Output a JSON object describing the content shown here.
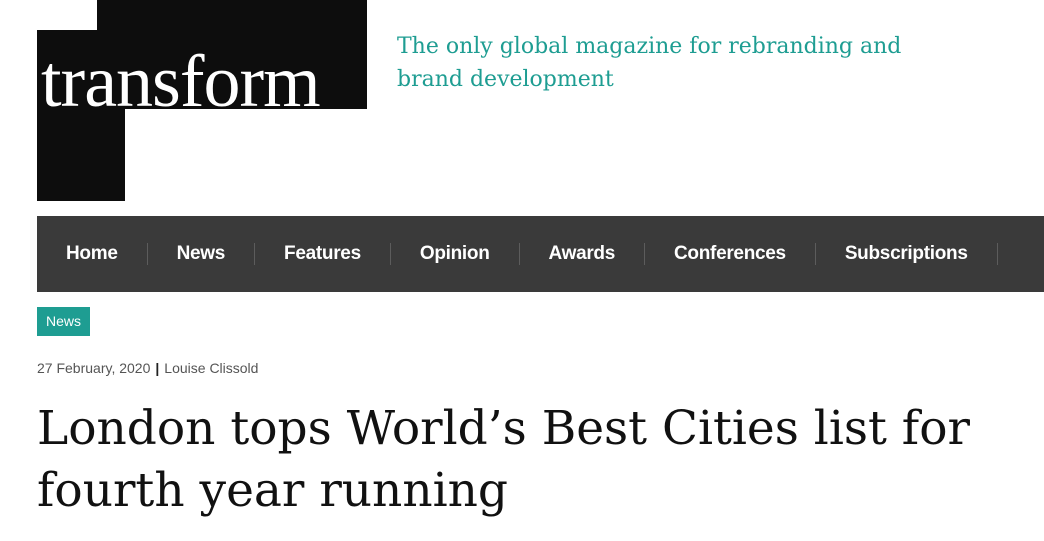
{
  "logo": {
    "text": "transform"
  },
  "tagline": "The only global magazine for rebranding and brand development",
  "nav": {
    "items": [
      {
        "label": "Home"
      },
      {
        "label": "News"
      },
      {
        "label": "Features"
      },
      {
        "label": "Opinion"
      },
      {
        "label": "Awards"
      },
      {
        "label": "Conferences"
      },
      {
        "label": "Subscriptions"
      }
    ]
  },
  "article": {
    "category": "News",
    "date": "27 February, 2020",
    "separator": "|",
    "author": "Louise Clissold",
    "title": "London tops World’s Best Cities list for fourth year running"
  },
  "colors": {
    "accent": "#1e9d92",
    "nav_bg": "#3a3a3a",
    "logo_bg": "#0d0d0d"
  }
}
